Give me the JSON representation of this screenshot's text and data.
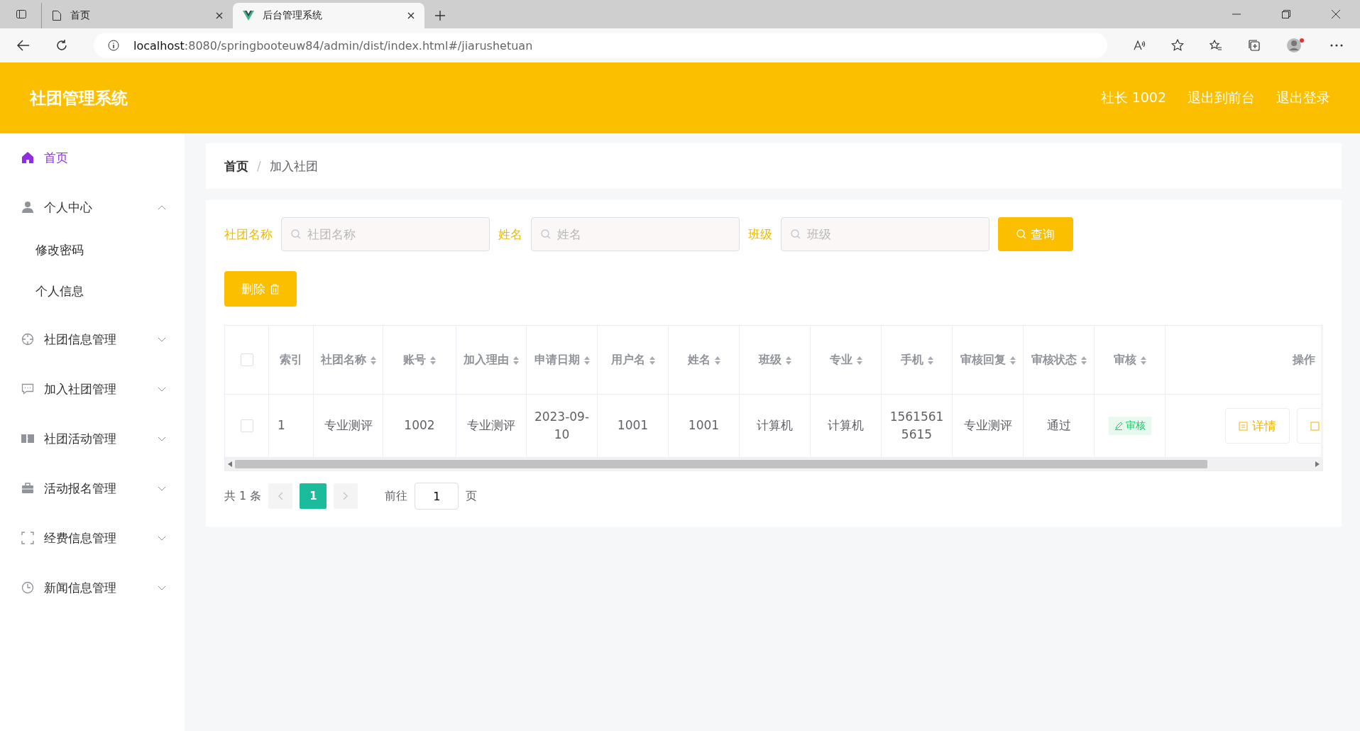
{
  "browser": {
    "tabs": [
      {
        "title": "首页",
        "selected": false
      },
      {
        "title": "后台管理系统",
        "selected": true
      }
    ],
    "url_host": "localhost",
    "url_rest": ":8080/springbooteuw84/admin/dist/index.html#/jiarushetuan"
  },
  "header": {
    "title": "社团管理系统",
    "links": [
      "社长 1002",
      "退出到前台",
      "退出登录"
    ]
  },
  "sidebar": {
    "items": [
      {
        "label": "首页",
        "selected": true,
        "expanded": false
      },
      {
        "label": "个人中心",
        "selected": false,
        "expanded": true,
        "children": [
          {
            "label": "修改密码"
          },
          {
            "label": "个人信息"
          }
        ]
      },
      {
        "label": "社团信息管理",
        "selected": false,
        "expanded": false
      },
      {
        "label": "加入社团管理",
        "selected": false,
        "expanded": false
      },
      {
        "label": "社团活动管理",
        "selected": false,
        "expanded": false
      },
      {
        "label": "活动报名管理",
        "selected": false,
        "expanded": false
      },
      {
        "label": "经费信息管理",
        "selected": false,
        "expanded": false
      },
      {
        "label": "新闻信息管理",
        "selected": false,
        "expanded": false
      }
    ]
  },
  "breadcrumb": [
    "首页",
    "加入社团"
  ],
  "breadcrumb_separator": "/",
  "filters": [
    {
      "label": "社团名称",
      "placeholder": "社团名称"
    },
    {
      "label": "姓名",
      "placeholder": "姓名"
    },
    {
      "label": "班级",
      "placeholder": "班级"
    }
  ],
  "search_button": "查询",
  "delete_button": "删除",
  "table": {
    "select_all_checked": false,
    "columns": [
      {
        "label": "索引",
        "sortable": false
      },
      {
        "label": "社团名称",
        "sortable": true
      },
      {
        "label": "账号",
        "sortable": true
      },
      {
        "label": "加入理由",
        "sortable": true
      },
      {
        "label": "申请日期",
        "sortable": true
      },
      {
        "label": "用户名",
        "sortable": true
      },
      {
        "label": "姓名",
        "sortable": true
      },
      {
        "label": "班级",
        "sortable": true
      },
      {
        "label": "专业",
        "sortable": true
      },
      {
        "label": "手机",
        "sortable": true
      },
      {
        "label": "审核回复",
        "sortable": true
      },
      {
        "label": "审核状态",
        "sortable": true
      },
      {
        "label": "审核",
        "sortable": true
      },
      {
        "label": "操作",
        "sortable": false
      }
    ],
    "rows": [
      {
        "checked": false,
        "cells": [
          "1",
          "专业测评",
          "1002",
          "专业测评",
          "2023-09-10",
          "1001",
          "1001",
          "计算机",
          "计算机",
          "15615615615",
          "专业测评",
          "通过"
        ],
        "review": "审核",
        "detail": "详情"
      }
    ]
  },
  "pagination": {
    "total": "共 1 条",
    "pages": [
      {
        "label": "1",
        "selected": true
      }
    ],
    "goto": "前往",
    "goto_value": "1",
    "unit": "页"
  }
}
